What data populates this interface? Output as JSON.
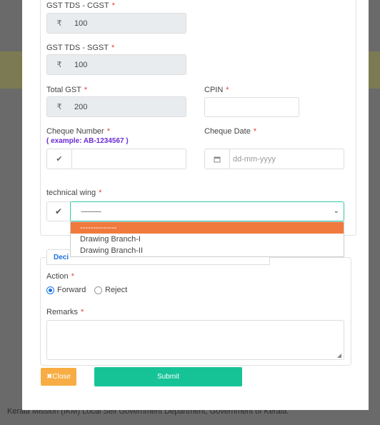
{
  "background": {
    "footer_text": "Kerala Mission (IKM) Local Self Government Department, Government of Kerala."
  },
  "form": {
    "gst_cgst": {
      "label": "GST TDS - CGST",
      "required": "*",
      "currency": "₹",
      "value": "100"
    },
    "gst_sgst": {
      "label": "GST TDS - SGST",
      "required": "*",
      "currency": "₹",
      "value": "100"
    },
    "total_gst": {
      "label": "Total GST",
      "required": "*",
      "currency": "₹",
      "value": "200"
    },
    "cpin": {
      "label": "CPIN",
      "required": "*",
      "value": ""
    },
    "cheque_number": {
      "label": "Cheque Number",
      "required": "*",
      "hint": "( example: AB-1234567 )",
      "value": ""
    },
    "cheque_date": {
      "label": "Cheque Date",
      "required": "*",
      "placeholder": "dd-mm-yyyy"
    },
    "technical_wing": {
      "label": "technical wing",
      "required": "*",
      "selected": "--------------",
      "options": [
        "--------------",
        "Drawing Branch-I",
        "Drawing Branch-II"
      ],
      "highlighted_index": 0
    }
  },
  "decision": {
    "tab_label": "Deci",
    "action_label": "Action",
    "action_required": "*",
    "action_options": [
      {
        "label": "Forward",
        "checked": true
      },
      {
        "label": "Reject",
        "checked": false
      }
    ],
    "remarks_label": "Remarks",
    "remarks_required": "*",
    "remarks_value": ""
  },
  "buttons": {
    "close_label": "✖Close",
    "submit_label": "Submit"
  },
  "colors": {
    "select_border": "#30c7a4",
    "dropdown_highlight": "#f07a3d",
    "close_button": "#f7ad43",
    "submit_button": "#15c397",
    "required_star": "#e23b3b",
    "hint_text": "#6a2ad4"
  }
}
